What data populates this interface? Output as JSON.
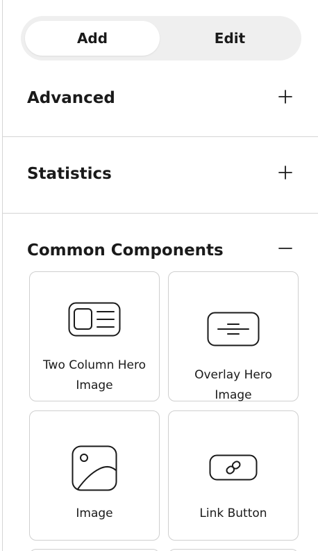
{
  "tabs": {
    "add_label": "Add",
    "edit_label": "Edit",
    "selected": "Add"
  },
  "sections": [
    {
      "title": "Advanced",
      "expanded": false,
      "toggle_icon": "plus-icon"
    },
    {
      "title": "Statistics",
      "expanded": false,
      "toggle_icon": "plus-icon"
    },
    {
      "title": "Common Components",
      "expanded": true,
      "toggle_icon": "minus-icon"
    }
  ],
  "components": [
    {
      "label": "Two Column Hero Image",
      "icon": "two-column-hero-icon"
    },
    {
      "label": "Overlay Hero Image",
      "icon": "overlay-hero-icon"
    },
    {
      "label": "Image",
      "icon": "image-icon"
    },
    {
      "label": "Link Button",
      "icon": "link-button-icon"
    }
  ]
}
